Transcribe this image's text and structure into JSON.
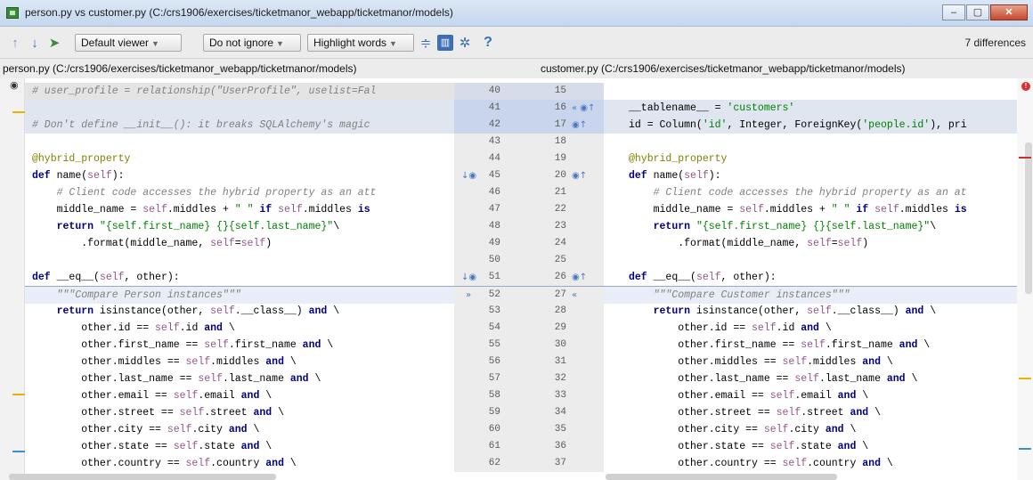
{
  "window": {
    "title": "person.py vs customer.py (C:/crs1906/exercises/ticketmanor_webapp/ticketmanor/models)",
    "buttons": [
      "–",
      "▢",
      "✕"
    ]
  },
  "toolbar": {
    "viewer_label": "Default viewer",
    "ignore_label": "Do not ignore",
    "highlight_label": "Highlight words",
    "help_label": "?",
    "differences": "7 differences"
  },
  "paths": {
    "left": "person.py (C:/crs1906/exercises/ticketmanor_webapp/ticketmanor/models)",
    "right": "customer.py (C:/crs1906/exercises/ticketmanor_webapp/ticketmanor/models)"
  },
  "icons": {
    "up": "arrow-up-icon",
    "down": "arrow-down-icon",
    "jump": "jump-to-source-icon",
    "align": "align-icon",
    "sidebyside": "side-by-side-icon",
    "settings": "gear-icon",
    "help": "help-icon",
    "eye": "eye-icon",
    "error": "error-icon"
  },
  "colors": {
    "changed": "#dfe6f0",
    "keyword": "#000080",
    "string": "#008000",
    "self": "#94558d",
    "comment": "#808080"
  },
  "rows": [
    {
      "l": "# user_profile = relationship(\"UserProfile\", uselist=Fal",
      "ln": "40",
      "rn": "15",
      "r": "",
      "t": "gray",
      "lt": "",
      "rt": ""
    },
    {
      "l": "",
      "ln": "41",
      "rn": "16",
      "r": "__tablename__ = 'customers'",
      "t": "changed",
      "lt": "",
      "rt": "« ◉↑"
    },
    {
      "l": "# Don't define __init__(): it breaks SQLAlchemy's magic",
      "ln": "42",
      "rn": "17",
      "r": "id = Column('id', Integer, ForeignKey('people.id'), pri",
      "t": "changed",
      "lt": "",
      "rt": "◉↑"
    },
    {
      "l": "",
      "ln": "43",
      "rn": "18",
      "r": "",
      "t": "",
      "lt": "",
      "rt": ""
    },
    {
      "l": "@hybrid_property",
      "ln": "44",
      "rn": "19",
      "r": "@hybrid_property",
      "t": "",
      "lt": "",
      "rt": ""
    },
    {
      "l": "def name(self):",
      "ln": "45",
      "rn": "20",
      "r": "def name(self):",
      "t": "",
      "lt": "↓◉",
      "rt": "◉↑"
    },
    {
      "l": "    # Client code accesses the hybrid property as an att",
      "ln": "46",
      "rn": "21",
      "r": "    # Client code accesses the hybrid property as an at",
      "t": "",
      "lt": "",
      "rt": ""
    },
    {
      "l": "    middle_name = self.middles + \" \" if self.middles is",
      "ln": "47",
      "rn": "22",
      "r": "    middle_name = self.middles + \" \" if self.middles is",
      "t": "",
      "lt": "",
      "rt": ""
    },
    {
      "l": "    return \"{self.first_name} {}{self.last_name}\"\\",
      "ln": "48",
      "rn": "23",
      "r": "    return \"{self.first_name} {}{self.last_name}\"\\",
      "t": "",
      "lt": "",
      "rt": ""
    },
    {
      "l": "        .format(middle_name, self=self)",
      "ln": "49",
      "rn": "24",
      "r": "        .format(middle_name, self=self)",
      "t": "",
      "lt": "",
      "rt": ""
    },
    {
      "l": "",
      "ln": "50",
      "rn": "25",
      "r": "",
      "t": "",
      "lt": "",
      "rt": ""
    },
    {
      "l": "def __eq__(self, other):",
      "ln": "51",
      "rn": "26",
      "r": "def __eq__(self, other):",
      "t": "",
      "lt": "↓◉",
      "rt": "◉↑"
    },
    {
      "l": "    \"\"\"Compare Person instances\"\"\"",
      "ln": "52",
      "rn": "27",
      "r": "    \"\"\"Compare Customer instances\"\"\"",
      "t": "sel",
      "lt": "»",
      "rt": "«"
    },
    {
      "l": "    return isinstance(other, self.__class__) and \\",
      "ln": "53",
      "rn": "28",
      "r": "    return isinstance(other, self.__class__) and \\",
      "t": "",
      "lt": "",
      "rt": ""
    },
    {
      "l": "        other.id == self.id and \\",
      "ln": "54",
      "rn": "29",
      "r": "        other.id == self.id and \\",
      "t": "",
      "lt": "",
      "rt": ""
    },
    {
      "l": "        other.first_name == self.first_name and \\",
      "ln": "55",
      "rn": "30",
      "r": "        other.first_name == self.first_name and \\",
      "t": "",
      "lt": "",
      "rt": ""
    },
    {
      "l": "        other.middles == self.middles and \\",
      "ln": "56",
      "rn": "31",
      "r": "        other.middles == self.middles and \\",
      "t": "",
      "lt": "",
      "rt": ""
    },
    {
      "l": "        other.last_name == self.last_name and \\",
      "ln": "57",
      "rn": "32",
      "r": "        other.last_name == self.last_name and \\",
      "t": "",
      "lt": "",
      "rt": ""
    },
    {
      "l": "        other.email == self.email and \\",
      "ln": "58",
      "rn": "33",
      "r": "        other.email == self.email and \\",
      "t": "",
      "lt": "",
      "rt": ""
    },
    {
      "l": "        other.street == self.street and \\",
      "ln": "59",
      "rn": "34",
      "r": "        other.street == self.street and \\",
      "t": "",
      "lt": "",
      "rt": ""
    },
    {
      "l": "        other.city == self.city and \\",
      "ln": "60",
      "rn": "35",
      "r": "        other.city == self.city and \\",
      "t": "",
      "lt": "",
      "rt": ""
    },
    {
      "l": "        other.state == self.state and \\",
      "ln": "61",
      "rn": "36",
      "r": "        other.state == self.state and \\",
      "t": "",
      "lt": "",
      "rt": ""
    },
    {
      "l": "        other.country == self.country and \\",
      "ln": "62",
      "rn": "37",
      "r": "        other.country == self.country and \\",
      "t": "",
      "lt": "",
      "rt": ""
    }
  ]
}
